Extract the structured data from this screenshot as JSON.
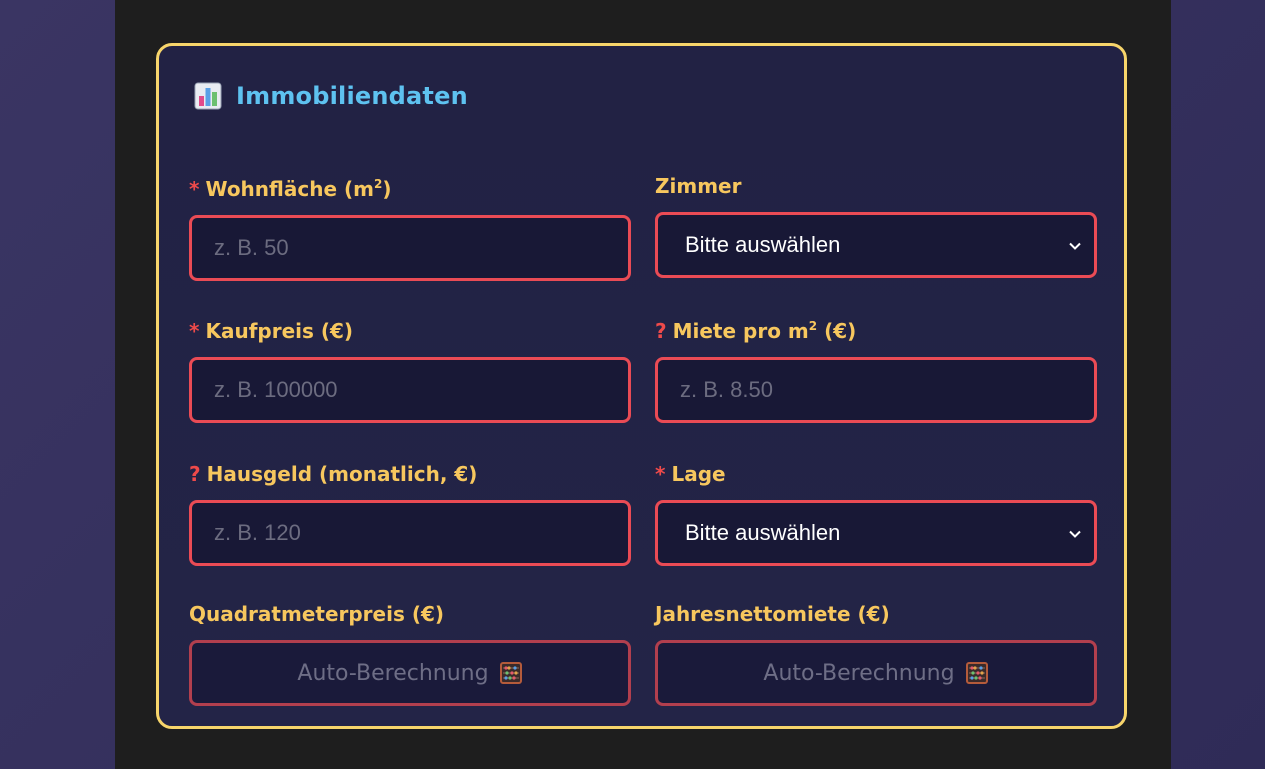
{
  "section": {
    "title": "Immobiliendaten",
    "icon": "bar-chart-icon"
  },
  "fields": {
    "wohnflaeche": {
      "marker": "*",
      "label": "Wohnfläche (m",
      "sup": "2",
      "label_end": ")",
      "placeholder": "z. B. 50"
    },
    "zimmer": {
      "label": "Zimmer",
      "selected": "Bitte auswählen"
    },
    "kaufpreis": {
      "marker": "*",
      "label": "Kaufpreis (€)",
      "placeholder": "z. B. 100000"
    },
    "miete": {
      "marker": "?",
      "label": "Miete pro m",
      "sup": "2",
      "label_end": " (€)",
      "placeholder": "z. B. 8.50"
    },
    "hausgeld": {
      "marker": "?",
      "label": "Hausgeld (monatlich, €)",
      "placeholder": "z. B. 120"
    },
    "lage": {
      "marker": "*",
      "label": "Lage",
      "selected": "Bitte auswählen"
    },
    "quadratmeterpreis": {
      "label": "Quadratmeterpreis (€)",
      "value": "Auto-Berechnung",
      "icon": "abacus-icon"
    },
    "jahresnettomiete": {
      "label": "Jahresnettomiete (€)",
      "value": "Auto-Berechnung",
      "icon": "abacus-icon"
    }
  },
  "colors": {
    "accent_title": "#5ec2f0",
    "label": "#f7c75e",
    "required_marker": "#ef4a4a",
    "field_border": "#ea4b55",
    "card_border": "#f7d56b"
  }
}
